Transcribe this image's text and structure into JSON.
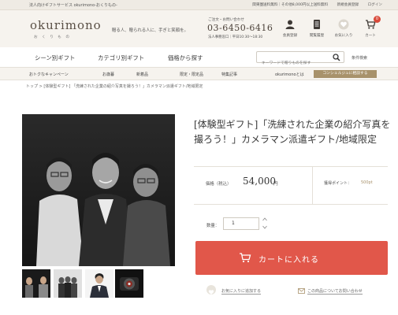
{
  "topbar": {
    "tagline": "法人向けギフトサービス okurimono-おくりもの-",
    "shipping": "関東圏送料無料｜その他8,000円以上送料無料",
    "signup": "新規会員登録",
    "login": "ログイン"
  },
  "header": {
    "logo": "okurimono",
    "logo_sub": "おくりもの",
    "tagline": "贈る人、贈られる人に、手ぎと笑顔を。",
    "phone_label": "ご注文・お問い合わせ",
    "phone": "03-6450-6416",
    "phone_hours": "法人事務窓口｜平日10:30〜18:30",
    "icons": [
      {
        "name": "member-icon",
        "label": "会員登録"
      },
      {
        "name": "history-icon",
        "label": "閲覧履歴"
      },
      {
        "name": "favorite-icon",
        "label": "お気に入り"
      },
      {
        "name": "cart-icon",
        "label": "カート",
        "badge": "0"
      }
    ]
  },
  "mainnav": {
    "items": [
      "シーン別ギフト",
      "カテゴリ別ギフト",
      "価格から探す"
    ],
    "search_placeholder": "キーワードで贈りものを探す",
    "help": "条件検索"
  },
  "subnav": {
    "items": [
      "おトクなキャンペーン",
      "お歳暮",
      "新着品",
      "限定・限定品",
      "特集記事"
    ],
    "about": "okurimonoとは",
    "concierge": "コンシェルジュに相談する"
  },
  "breadcrumb": "トップ > [体験型ギフト] 「洗練された企業の紹介写真を撮ろう！」カメラマン派遣ギフト/地域限定",
  "product": {
    "title": "[体験型ギフト]「洗練された企業の紹介写真を撮ろう！」カメラマン派遣ギフト/地域限定",
    "price_label": "価格（税込）",
    "price": "54,000",
    "price_unit": "円",
    "points_label": "獲得ポイント：",
    "points": "500pt",
    "qty_label": "数量：",
    "qty": "1",
    "cart_label": "カートに入れる",
    "fav_label": "お気に入りに追加する",
    "inquiry_label": "この商品についてお問い合わせ"
  },
  "colors": {
    "accent": "#e1574a",
    "gold": "#a8926b",
    "header_bg": "#f6f3ee"
  }
}
